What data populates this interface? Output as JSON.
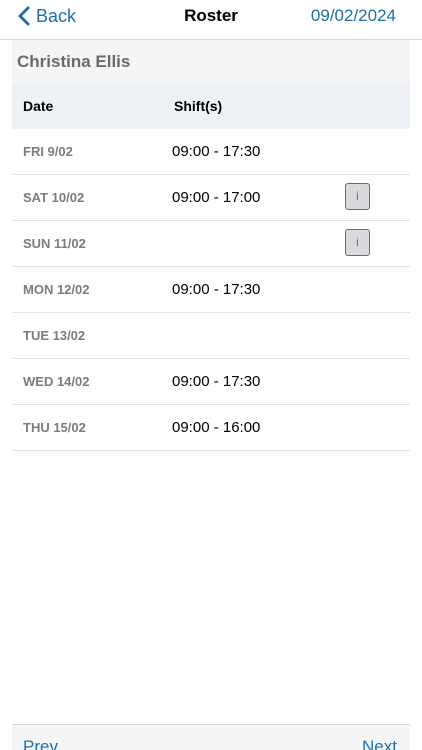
{
  "navbar": {
    "back_label": "Back",
    "title": "Roster",
    "date": "09/02/2024"
  },
  "employee": {
    "name": "Christina Ellis"
  },
  "table": {
    "columns": [
      "Date",
      "Shift(s)"
    ],
    "rows": [
      {
        "date": "FRI 9/02",
        "shift": "09:00 - 17:30",
        "info": false
      },
      {
        "date": "SAT 10/02",
        "shift": "09:00 - 17:00",
        "info": true
      },
      {
        "date": "SUN 11/02",
        "shift": "",
        "info": true
      },
      {
        "date": "MON 12/02",
        "shift": "09:00 - 17:30",
        "info": false
      },
      {
        "date": "TUE 13/02",
        "shift": "",
        "info": false
      },
      {
        "date": "WED 14/02",
        "shift": "09:00 - 17:30",
        "info": false
      },
      {
        "date": "THU 15/02",
        "shift": "09:00 - 16:00",
        "info": false
      }
    ],
    "info_label": "i"
  },
  "pager": {
    "prev_label": "Prev",
    "next_label": "Next"
  },
  "colors": {
    "accent": "#1f6fa8",
    "header_bg": "#eef1f5",
    "name_bg": "#f4f5f7"
  },
  "icons": {
    "back": "chevron-left-icon",
    "info": "info-icon"
  }
}
